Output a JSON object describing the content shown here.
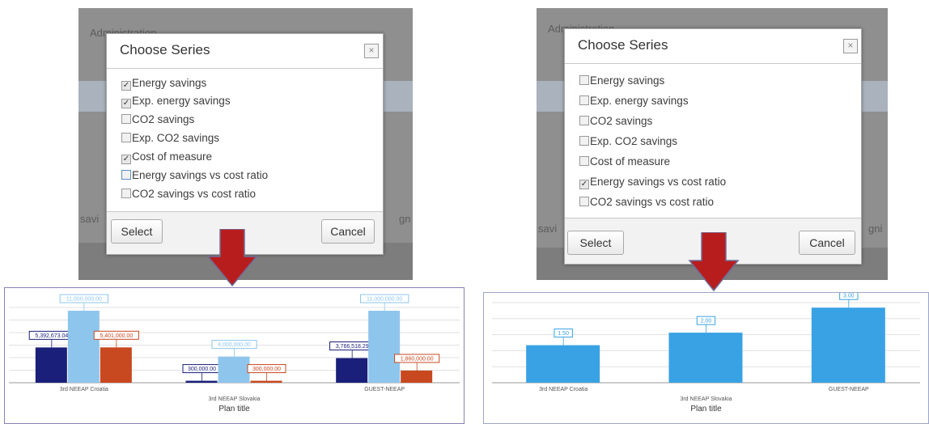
{
  "left_panel": {
    "background_label": "Administration",
    "background_side_left": "savi",
    "background_side_right": "gn",
    "dialog": {
      "title": "Choose Series",
      "close_glyph": "×",
      "options": [
        {
          "label": "Energy savings",
          "checked": true
        },
        {
          "label": "Exp. energy savings",
          "checked": true
        },
        {
          "label": "CO2 savings",
          "checked": false
        },
        {
          "label": "Exp. CO2 savings",
          "checked": false
        },
        {
          "label": "Cost of measure",
          "checked": true
        },
        {
          "label": "Energy savings vs cost ratio",
          "checked": false
        },
        {
          "label": "CO2 savings vs cost ratio",
          "checked": false
        }
      ],
      "select_label": "Select",
      "cancel_label": "Cancel"
    }
  },
  "right_panel": {
    "background_label": "Administration",
    "background_side_left": "savi",
    "background_side_right": "gni",
    "dialog": {
      "title": "Choose Series",
      "close_glyph": "×",
      "options": [
        {
          "label": "Energy savings",
          "checked": false
        },
        {
          "label": "Exp. energy savings",
          "checked": false
        },
        {
          "label": "CO2 savings",
          "checked": false
        },
        {
          "label": "Exp. CO2 savings",
          "checked": false
        },
        {
          "label": "Cost of measure",
          "checked": false
        },
        {
          "label": "Energy savings vs cost ratio",
          "checked": true
        },
        {
          "label": "CO2 savings vs cost ratio",
          "checked": false
        }
      ],
      "select_label": "Select",
      "cancel_label": "Cancel"
    }
  },
  "arrow_color": "#b81d1d",
  "chart_data": [
    {
      "type": "bar",
      "categories": [
        "3rd NEEAP Croatia",
        "3rd NEEAP Slovakia",
        "GUEST-NEEAP"
      ],
      "xlabel": "Plan title",
      "ylim": [
        0,
        11500000
      ],
      "grid": true,
      "series": [
        {
          "color": "#1a1f7a",
          "values": [
            5392673.04,
            300000.0,
            3766518.29
          ],
          "labels": [
            "5,392,673.04",
            "300,000.00",
            "3,766,518.29"
          ]
        },
        {
          "color": "#8ec5ec",
          "values": [
            11000000.0,
            4000000.0,
            11000000.0
          ],
          "labels": [
            "11,000,000.00",
            "4,000,000.00",
            "11,000,000.00"
          ]
        },
        {
          "color": "#c8481f",
          "values": [
            5401000.0,
            300000.0,
            1860000.0
          ],
          "labels": [
            "5,401,000.00",
            "300,000.00",
            "1,860,000.00"
          ]
        }
      ]
    },
    {
      "type": "bar",
      "categories": [
        "3rd NEEAP Croatia",
        "3rd NEEAP Slovakia",
        "GUEST-NEEAP"
      ],
      "xlabel": "Plan title",
      "ylim": [
        0,
        3.2
      ],
      "grid": true,
      "series": [
        {
          "color": "#39a2e4",
          "values": [
            1.5,
            2.0,
            3.0
          ],
          "labels": [
            "1.50",
            "2.00",
            "3.00"
          ]
        }
      ]
    }
  ]
}
